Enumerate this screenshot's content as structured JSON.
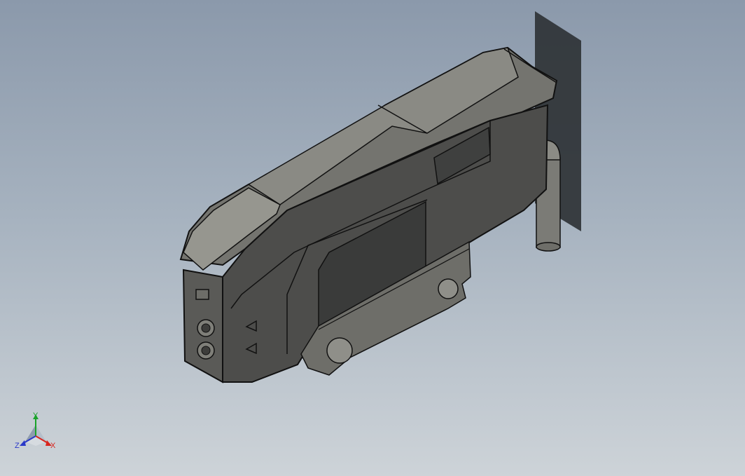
{
  "viewport": {
    "background_top": "#8b99ab",
    "background_bottom": "#cdd3d8"
  },
  "model": {
    "colors": {
      "body_dark": "#4d4d4b",
      "body_side": "#5a5a57",
      "top_light": "#8a8a84",
      "top_mid": "#74746f",
      "edge": "#111111",
      "panel_dark": "#3a3b3a",
      "shadow_plate": "#2f3336"
    }
  },
  "triad": {
    "x_label": "X",
    "y_label": "Y",
    "z_label": "Z",
    "x_color": "#d8261f",
    "y_color": "#1aa32a",
    "z_color": "#2a39c8"
  }
}
